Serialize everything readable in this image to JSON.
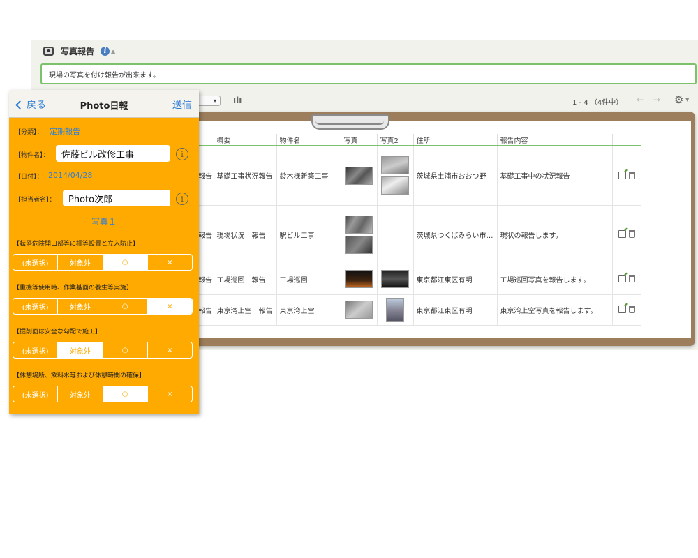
{
  "app": {
    "title": "写真報告",
    "info_icon": "i",
    "description": "現場の写真を付け報告が出来ます。"
  },
  "toolbar": {
    "view_select": "▾",
    "chart_icon": "ılı",
    "pager": "1 - 4 （4件中）",
    "prev": "←",
    "next": "→",
    "gear": "⚙"
  },
  "table": {
    "headers": [
      "",
      "概要",
      "物件名",
      "写真",
      "写真2",
      "住所",
      "報告内容",
      ""
    ],
    "rows": [
      {
        "type": "報告",
        "summary": "基礎工事状況報告",
        "property": "鈴木様新築工事",
        "address": "茨城県土浦市おおつ野",
        "content": "基礎工事中の状況報告"
      },
      {
        "type": "報告",
        "summary": "現場状況　報告",
        "property": "駅ビル工事",
        "address": "茨城県つくばみらい市…",
        "content": "現状の報告します。"
      },
      {
        "type": "報告",
        "summary": "工場巡回　報告",
        "property": "工場巡回",
        "address": "東京都江東区有明",
        "content": "工場巡回写真を報告します。"
      },
      {
        "type": "報告",
        "summary": "東京湾上空　報告",
        "property": "東京湾上空",
        "address": "東京都江東区有明",
        "content": "東京湾上空写真を報告します。"
      }
    ]
  },
  "mobile": {
    "nav": {
      "back": "戻る",
      "title": "Photo日報",
      "send": "送信"
    },
    "category": {
      "label": "【分類】：",
      "value": "定期報告"
    },
    "property": {
      "label": "【物件名】：",
      "value": "佐藤ビル改修工事"
    },
    "date": {
      "label": "【日付】：",
      "value": "2014/04/28"
    },
    "person": {
      "label": "【担当者名】：",
      "value": "Photo次郎"
    },
    "info_icon": "i",
    "section": "写真１",
    "questions": [
      {
        "label": "【転落危険開口部等に柵等設置と立入防止】",
        "selected": 2
      },
      {
        "label": "【重機等使用時、作業基面の養生等実施】",
        "selected": 3
      },
      {
        "label": "【掘削面は安全な勾配で施工】",
        "selected": 1
      },
      {
        "label": "【休憩場所、飲料水等および休憩時間の確保】",
        "selected": 2
      }
    ],
    "options": [
      "(未選択)",
      "対象外",
      "○",
      "×"
    ]
  }
}
